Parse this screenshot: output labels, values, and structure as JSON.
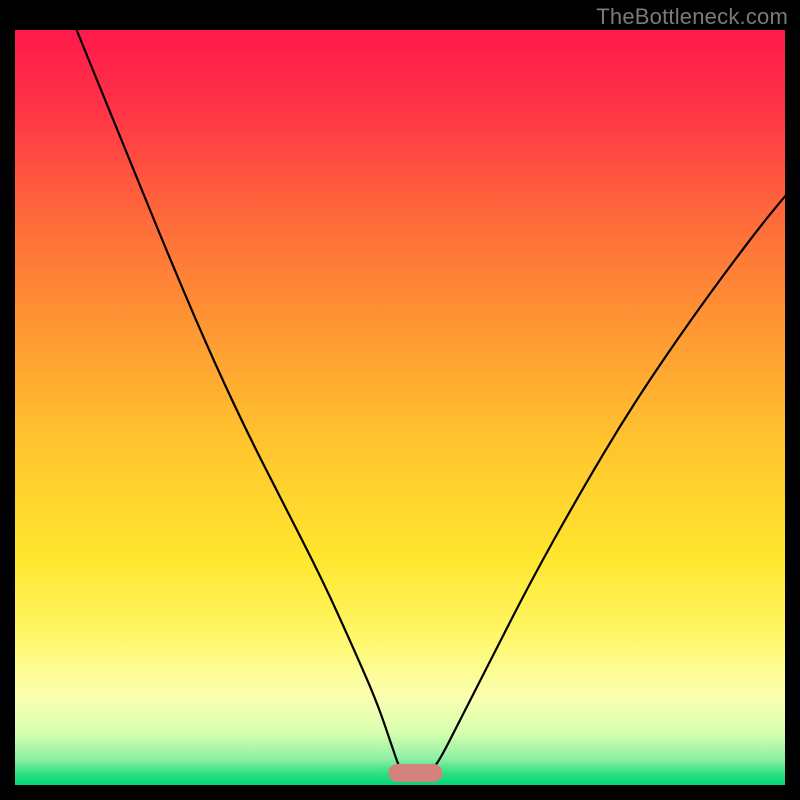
{
  "watermark": "TheBottleneck.com",
  "chart_data": {
    "type": "line",
    "title": "",
    "xlabel": "",
    "ylabel": "",
    "xlim": [
      0,
      100
    ],
    "ylim": [
      0,
      100
    ],
    "grid": false,
    "legend": false,
    "background": {
      "type": "vertical-gradient",
      "stops": [
        {
          "pos": 0.0,
          "color": "#ff1a4b"
        },
        {
          "pos": 0.1,
          "color": "#ff3247"
        },
        {
          "pos": 0.25,
          "color": "#ff6a3a"
        },
        {
          "pos": 0.4,
          "color": "#ff9933"
        },
        {
          "pos": 0.55,
          "color": "#ffc52e"
        },
        {
          "pos": 0.7,
          "color": "#ffe62e"
        },
        {
          "pos": 0.8,
          "color": "#fff766"
        },
        {
          "pos": 0.88,
          "color": "#fcffb0"
        },
        {
          "pos": 0.93,
          "color": "#d9ffb0"
        },
        {
          "pos": 0.965,
          "color": "#8ff0a4"
        },
        {
          "pos": 0.985,
          "color": "#2ee082"
        },
        {
          "pos": 1.0,
          "color": "#00d477"
        }
      ]
    },
    "series": [
      {
        "name": "bottleneck-curve",
        "stroke": "#000000",
        "stroke_width": 2.2,
        "x": [
          8,
          12,
          16,
          20,
          25,
          30,
          35,
          40,
          44,
          47,
          49,
          50,
          51,
          52,
          54,
          55,
          58,
          62,
          67,
          73,
          80,
          88,
          96,
          100
        ],
        "values": [
          100,
          90,
          80,
          70,
          58,
          47,
          37,
          27,
          18,
          11,
          5,
          2,
          2,
          2,
          2,
          3,
          9,
          17,
          27,
          38,
          50,
          62,
          73,
          78
        ]
      }
    ],
    "marker": {
      "name": "optimal-range",
      "shape": "rounded-rect",
      "x_center": 52,
      "y_center": 1.6,
      "width": 7,
      "height": 2.4,
      "fill": "#d4827e"
    }
  }
}
